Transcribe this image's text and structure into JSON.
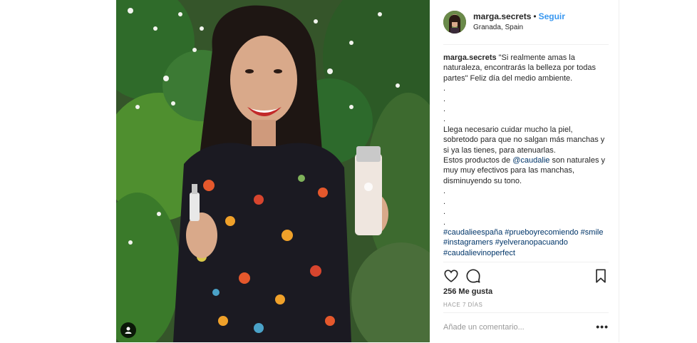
{
  "post": {
    "header": {
      "username": "marga.secrets",
      "separator": "•",
      "follow_label": "Seguir",
      "location": "Granada, Spain"
    },
    "caption": {
      "username": "marga.secrets",
      "text_intro": "\"Si realmente amas la naturaleza, encontrarás la belleza por todas partes\" Feliz día del medio ambiente.",
      "dots_1": [
        ".",
        ".",
        ".",
        "."
      ],
      "paragraph_1": "Llega necesario cuidar mucho la piel, sobretodo para que no salgan más manchas y si ya las tienes, para atenuarlas.",
      "paragraph_2_before": "Estos productos de ",
      "mention": "@caudalie",
      "paragraph_2_after": " son naturales y muy muy efectivos para las manchas, disminuyendo su tono.",
      "dots_2": [
        ".",
        ".",
        ".",
        "."
      ],
      "hashtags": [
        "#caudalieespaña",
        "#prueboyrecomiendo",
        "#smile",
        "#instagramers",
        "#yelveranopacuando",
        "#caudalievinoperfect"
      ]
    },
    "icons": {
      "like": "heart-icon",
      "comment": "comment-icon",
      "save": "bookmark-icon",
      "tag": "user-tag-icon",
      "more": "more-options-icon"
    },
    "likes": "256 Me gusta",
    "timestamp": "HACE 7 DÍAS",
    "comment": {
      "placeholder": "Añade un comentario...",
      "value": "",
      "more_label": "•••"
    },
    "colors": {
      "link": "#3897f0",
      "hashtag": "#003569",
      "text": "#262626",
      "muted": "#999999",
      "divider": "#efefef"
    }
  }
}
